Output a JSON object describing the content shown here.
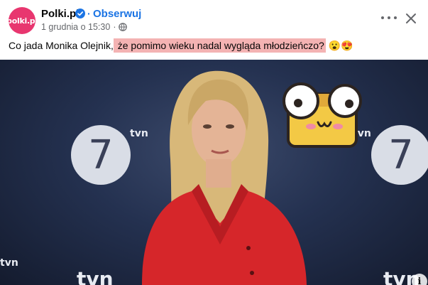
{
  "post": {
    "page_name": "Polki.pl",
    "avatar_text": "polki.pl",
    "separator": "·",
    "follow_label": "Obserwuj",
    "timestamp": "1 grudnia o 15:30",
    "meta_separator": "·",
    "text_before": "Co jada Monika Olejnik,",
    "text_highlight": " że pomimo wieku nadal wygląda młodzieńczo?",
    "text_emojis": "😮😍"
  },
  "photo": {
    "logo_seven": "7",
    "logo_tvn": "tvn",
    "info_label": "i"
  },
  "colors": {
    "brand": "#e8366f",
    "link": "#1b74e4",
    "highlight": "#f4b3b3",
    "secondary_text": "#65676b"
  }
}
